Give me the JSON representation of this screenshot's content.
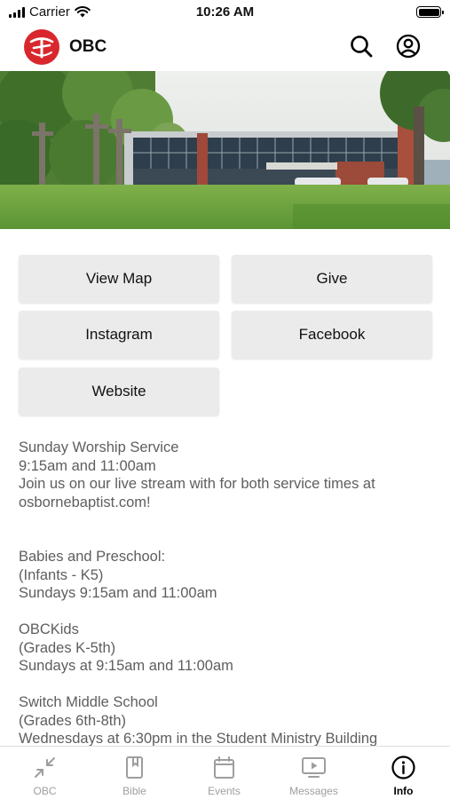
{
  "status_bar": {
    "carrier": "Carrier",
    "time": "10:26 AM"
  },
  "header": {
    "title": "OBC"
  },
  "buttons": {
    "view_map": "View Map",
    "give": "Give",
    "instagram": "Instagram",
    "facebook": "Facebook",
    "website": "Website"
  },
  "info": {
    "worship": [
      "Sunday Worship Service",
      "9:15am and 11:00am",
      "Join us on our live stream with for both service times at",
      "osbornebaptist.com!"
    ],
    "preschool": [
      "Babies and Preschool:",
      "(Infants - K5)",
      "Sundays 9:15am and 11:00am"
    ],
    "kids": [
      "OBCKids",
      "(Grades K-5th)",
      "Sundays at 9:15am and 11:00am"
    ],
    "middle": [
      "Switch Middle School",
      "(Grades 6th-8th)",
      "Wednesdays at 6:30pm in the Student Ministry Building"
    ]
  },
  "tabs": [
    "OBC",
    "Bible",
    "Events",
    "Messages",
    "Info"
  ],
  "active_tab": "Info",
  "colors": {
    "brand": "#d9272e",
    "button_bg": "#ebebeb",
    "body_text": "#5e5e5e",
    "tab_inactive": "#9e9e9e"
  }
}
